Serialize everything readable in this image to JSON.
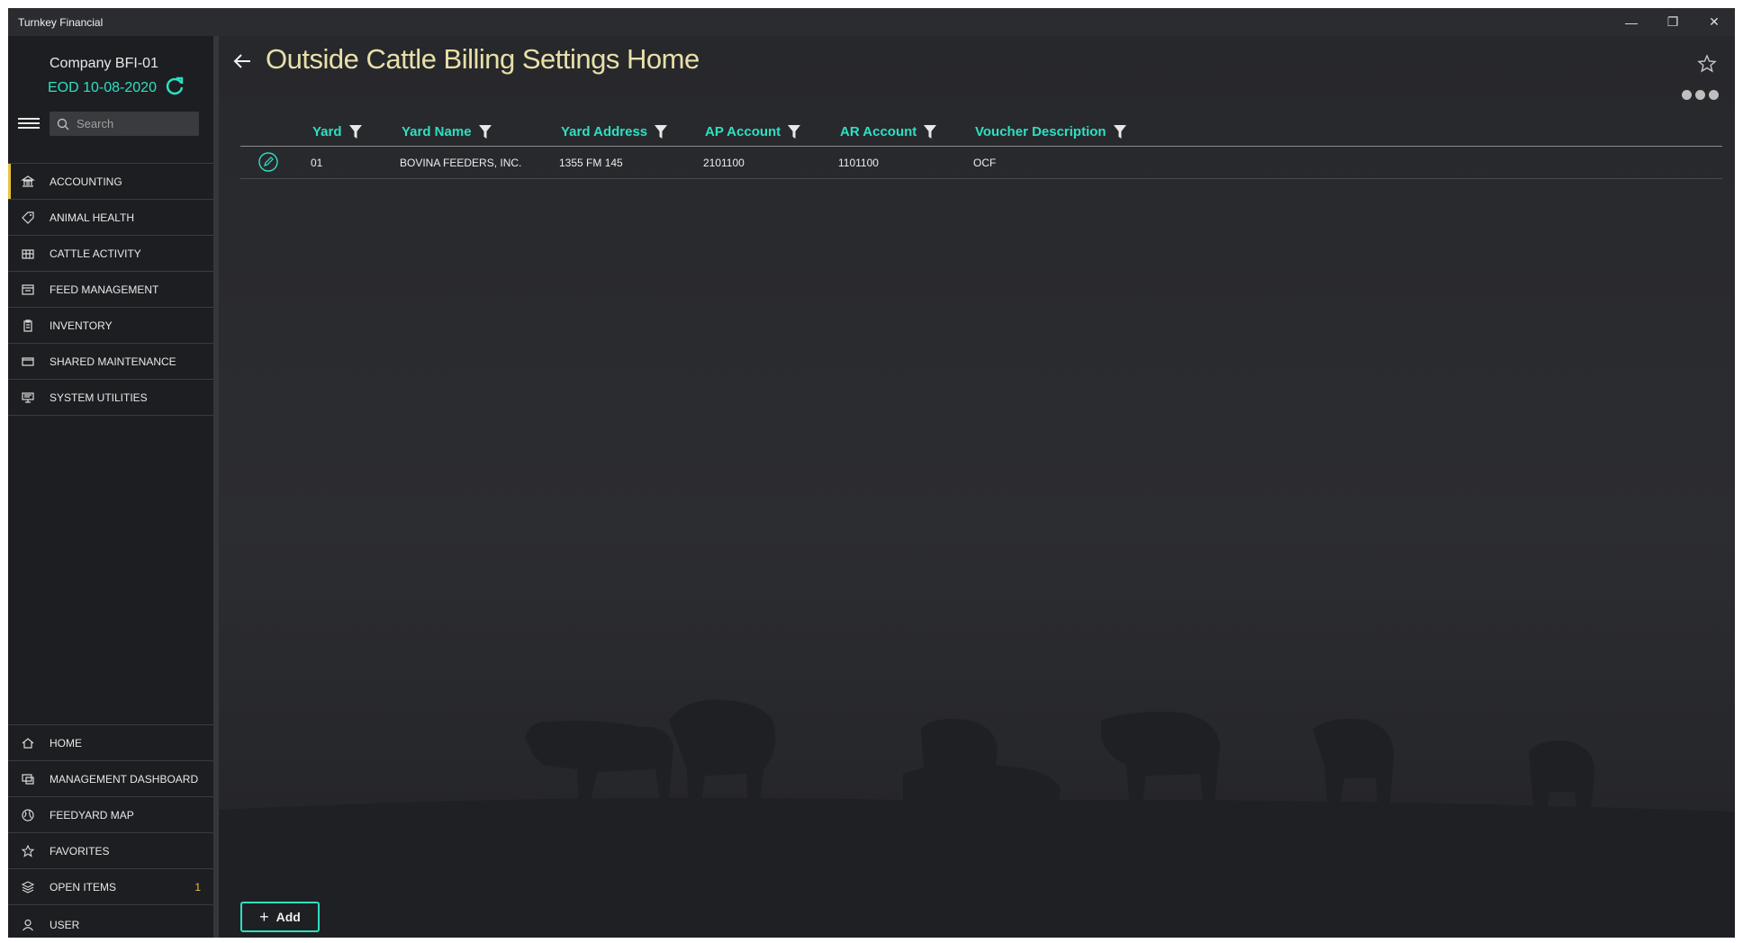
{
  "window": {
    "title": "Turnkey Financial",
    "controls": {
      "minimize": "—",
      "restore": "❐",
      "close": "✕"
    }
  },
  "sidebar": {
    "company": "Company BFI-01",
    "eod": "EOD 10-08-2020",
    "search_placeholder": "Search",
    "nav_top": [
      {
        "label": "ACCOUNTING",
        "icon": "bank-icon",
        "active": true
      },
      {
        "label": "ANIMAL HEALTH",
        "icon": "tag-icon"
      },
      {
        "label": "CATTLE ACTIVITY",
        "icon": "grid-icon"
      },
      {
        "label": "FEED MANAGEMENT",
        "icon": "feed-icon"
      },
      {
        "label": "INVENTORY",
        "icon": "clipboard-icon"
      },
      {
        "label": "SHARED MAINTENANCE",
        "icon": "folder-icon"
      },
      {
        "label": "SYSTEM UTILITIES",
        "icon": "monitor-icon"
      }
    ],
    "nav_bottom": [
      {
        "label": "HOME",
        "icon": "home-icon"
      },
      {
        "label": "MANAGEMENT DASHBOARD",
        "icon": "dashboard-icon"
      },
      {
        "label": "FEEDYARD MAP",
        "icon": "globe-icon"
      },
      {
        "label": "FAVORITES",
        "icon": "star-icon"
      },
      {
        "label": "OPEN ITEMS",
        "icon": "layers-icon",
        "count": "1"
      },
      {
        "label": "USER",
        "icon": "user-icon"
      }
    ]
  },
  "main": {
    "title": "Outside Cattle Billing Settings Home",
    "columns": [
      "Yard",
      "Yard Name",
      "Yard Address",
      "AP Account",
      "AR Account",
      "Voucher Description"
    ],
    "rows": [
      {
        "yard": "01",
        "yard_name": "BOVINA FEEDERS, INC.",
        "yard_address": "1355 FM 145",
        "ap_account": "2101100",
        "ar_account": "1101100",
        "voucher_description": "OCF"
      }
    ],
    "add_label": "Add"
  },
  "colors": {
    "accent": "#2de0c2",
    "title": "#e8e0a8",
    "active_bar": "#e8c33a"
  }
}
